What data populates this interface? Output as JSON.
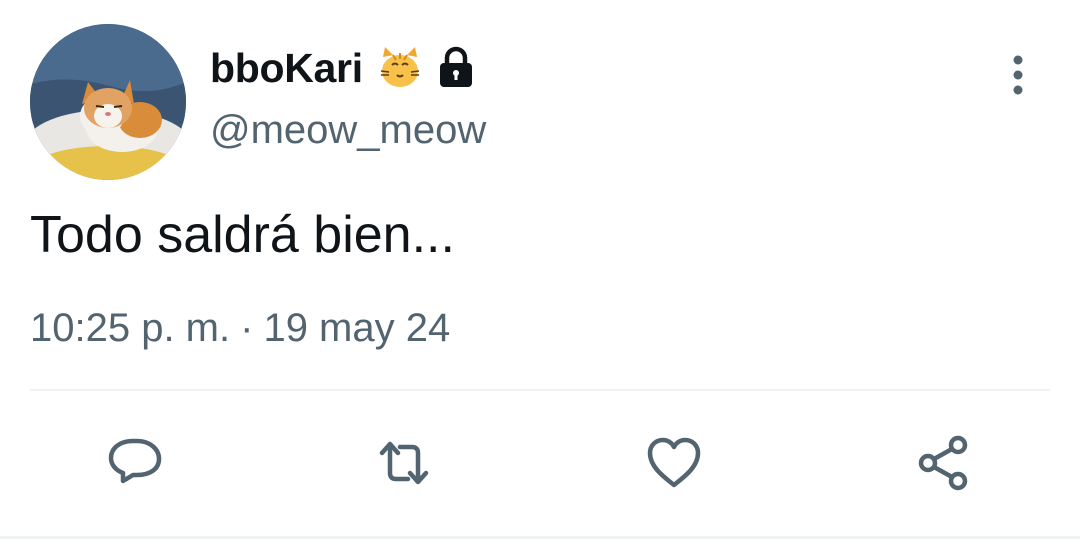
{
  "tweet": {
    "display_name": "bboKari",
    "handle": "@meow_meow",
    "text": "Todo saldrá bien...",
    "time": "10:25 p. m.",
    "separator": "·",
    "date": "19 may 24"
  },
  "icons": {
    "avatar": "cat-photo-avatar",
    "badge_emoji": "cat-face-emoji",
    "protected": "lock-icon",
    "more": "more-vertical-icon",
    "reply": "reply-icon",
    "retweet": "retweet-icon",
    "like": "heart-icon",
    "share": "share-icon"
  },
  "colors": {
    "text_primary": "#0f1419",
    "text_secondary": "#536471",
    "icon_gray": "#536471",
    "divider": "#eff3f4"
  }
}
